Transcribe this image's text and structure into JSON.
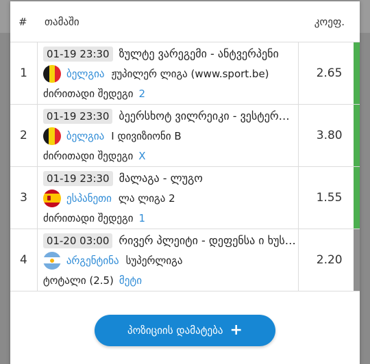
{
  "header": {
    "num": "#",
    "game": "თამაში",
    "odds": "კოეფ."
  },
  "rows": [
    {
      "num": "1",
      "date": "01-19 23:30",
      "match": "ზულტე ვარეგემი - ანტვერპენი",
      "country": "ბელგია",
      "flag": "belgium-flag",
      "league": "ჟუპილერ ლიგა (www.sport.be)",
      "market": "ძირითადი შედეგი",
      "pick": "2",
      "odds": "2.65",
      "status_color": "#4caf50"
    },
    {
      "num": "2",
      "date": "01-19 23:30",
      "match": "ბეერსხოტ ვილრეიკი - ვესტერლო",
      "country": "ბელგია",
      "flag": "belgium-flag",
      "league": "I დივიზიონი B",
      "market": "ძირითადი შედეგი",
      "pick": "X",
      "odds": "3.80",
      "status_color": "#4caf50"
    },
    {
      "num": "3",
      "date": "01-19 23:30",
      "match": "მალაგა - ლუგო",
      "country": "ესპანეთი",
      "flag": "spain-flag",
      "league": "ლა ლიგა 2",
      "market": "ძირითადი შედეგი",
      "pick": "1",
      "odds": "1.55",
      "status_color": "#4caf50"
    },
    {
      "num": "4",
      "date": "01-20 03:00",
      "match": "რივერ პლეიტი - დეფენსა ი ხუსტისია",
      "country": "არგენტინა",
      "flag": "argentina-flag",
      "league": "სუპერლიგა",
      "market": "ტოტალი (2.5)",
      "pick": "მეტი",
      "odds": "2.20",
      "status_color": "#8f8f8f"
    }
  ],
  "add_button": {
    "label": "პოზიციის დამატება",
    "icon": "plus-icon"
  }
}
